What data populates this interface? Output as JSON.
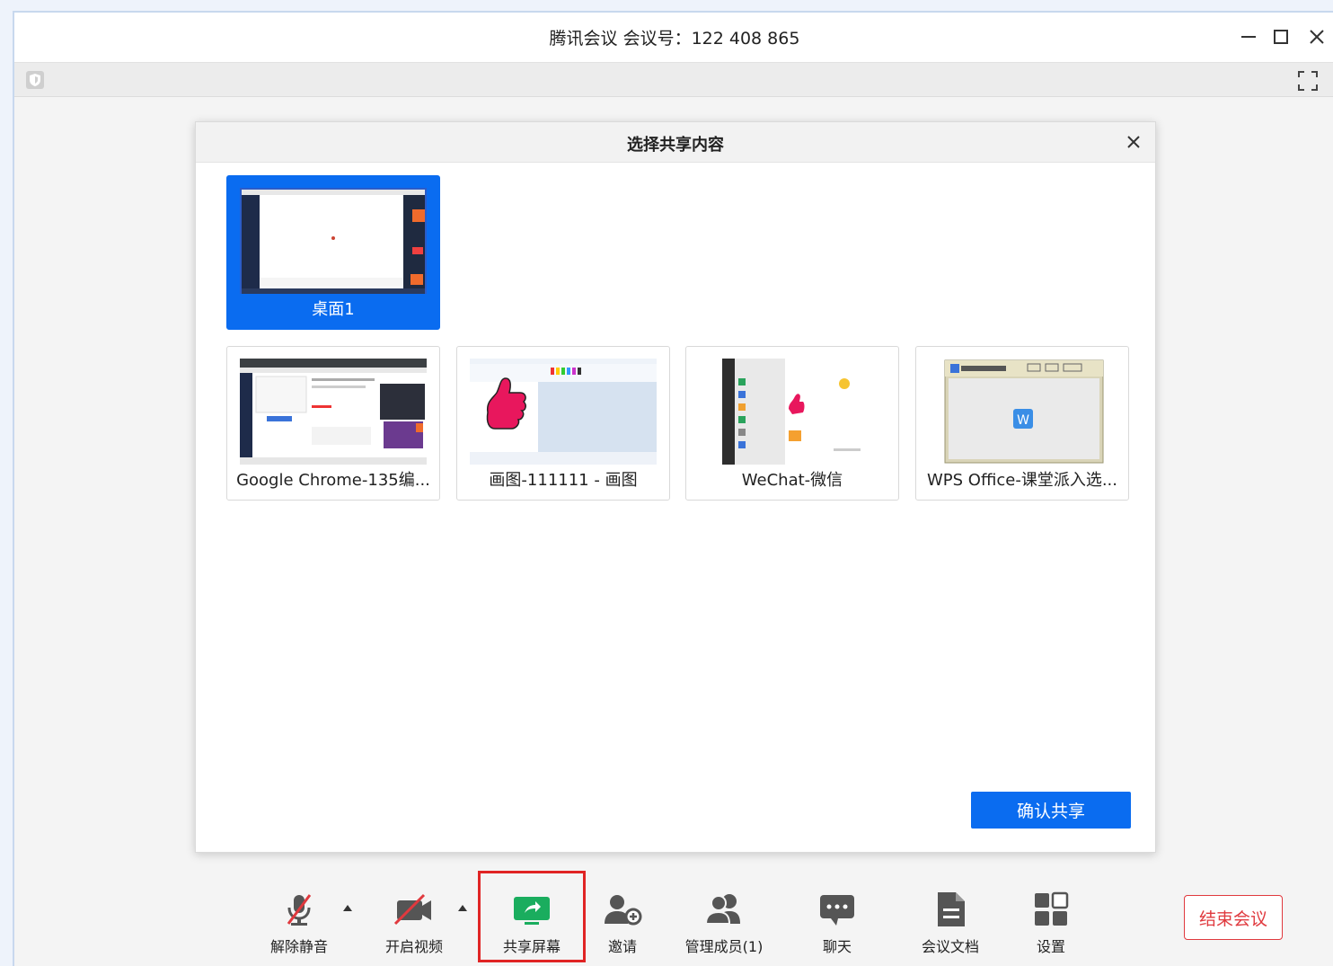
{
  "window": {
    "title": "腾讯会议 会议号：122 408 865"
  },
  "dialog": {
    "title": "选择共享内容",
    "desktops": [
      {
        "label": "桌面1",
        "selected": true
      }
    ],
    "windows": [
      {
        "label": "Google Chrome-135编..."
      },
      {
        "label": "画图-111111 - 画图"
      },
      {
        "label": "WeChat-微信"
      },
      {
        "label": "WPS Office-课堂派入选..."
      }
    ],
    "confirm_label": "确认共享"
  },
  "toolbar": {
    "items": [
      {
        "label": "解除静音",
        "icon": "mic-muted-icon"
      },
      {
        "label": "开启视频",
        "icon": "video-off-icon"
      },
      {
        "label": "共享屏幕",
        "icon": "share-screen-icon"
      },
      {
        "label": "邀请",
        "icon": "invite-icon"
      },
      {
        "label": "管理成员(1)",
        "icon": "members-icon"
      },
      {
        "label": "聊天",
        "icon": "chat-icon"
      },
      {
        "label": "会议文档",
        "icon": "document-icon"
      },
      {
        "label": "设置",
        "icon": "settings-icon"
      }
    ],
    "end_label": "结束会议"
  },
  "colors": {
    "accent": "#0a6cf0",
    "share_green": "#1aad5e",
    "end_red": "#e0393e",
    "highlight_red": "#e02424"
  }
}
